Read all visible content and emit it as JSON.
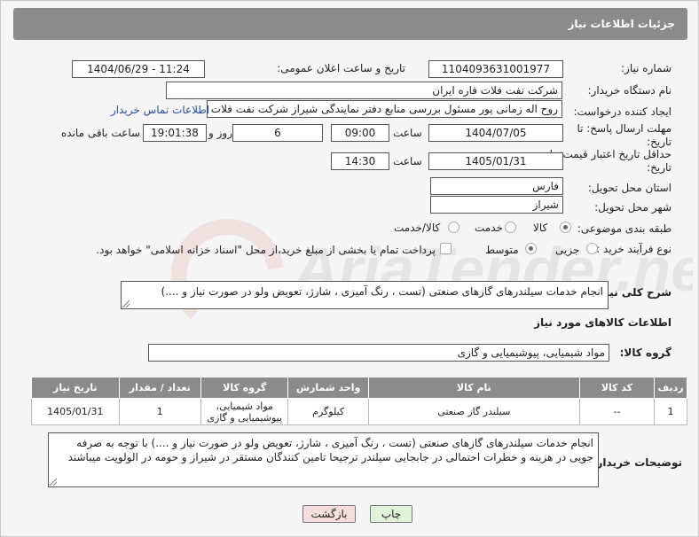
{
  "header": {
    "title": "جزئیات اطلاعات نیاز"
  },
  "fields": {
    "need_number_label": "شماره نیاز:",
    "need_number": "1104093631001977",
    "announce_label": "تاریخ و ساعت اعلان عمومی:",
    "announce_value": "1404/06/29 - 11:24",
    "buyer_org_label": "نام دستگاه خریدار:",
    "buyer_org": "شرکت نفت فلات قاره ایران",
    "creator_label": "ایجاد کننده درخواست:",
    "creator": "روح اله زمانی پور مسئول بررسی منابع دفتر نمایندگی شیراز شرکت نفت فلات ق",
    "contact_link": "اطلاعات تماس خریدار",
    "deadline_label": "مهلت ارسال پاسخ: تا تاریخ:",
    "deadline_date": "1404/07/05",
    "time_word": "ساعت",
    "deadline_time": "09:00",
    "days_value": "6",
    "days_word": "روز و",
    "remaining_time": "19:01:38",
    "remaining_word": "ساعت باقی مانده",
    "min_price_label": "حداقل تاریخ اعتبار قیمت: تا تاریخ:",
    "min_price_date": "1405/01/31",
    "min_price_time": "14:30",
    "province_label": "استان محل تحویل:",
    "province": "فارس",
    "city_label": "شهر محل تحویل:",
    "city": "شیراز",
    "category_label": "طبقه بندی موضوعی:",
    "category_options": [
      "کالا",
      "خدمت",
      "کالا/خدمت"
    ],
    "category_selected": "کالا",
    "process_label": "نوع فرآیند خرید :",
    "process_options": [
      "جزیی",
      "متوسط"
    ],
    "process_selected": "متوسط",
    "payment_note": "پرداخت تمام یا بخشی از مبلغ خرید،از محل \"اسناد خزانه اسلامی\" خواهد بود."
  },
  "description": {
    "label": "شرح کلی نیاز:",
    "text": "انجام خدمات سیلندرهای گازهای صنعتی (تست ، رنگ آمیزی ، شارژ، تعویض ولو در صورت نیاز و ....)"
  },
  "goods_section": {
    "title": "اطلاعات کالاهای مورد نیاز",
    "group_label": "گروه کالا:",
    "group_value": "مواد شیمیایی، پیوشیمیایی و  گازی"
  },
  "table": {
    "headers": [
      "ردیف",
      "کد کالا",
      "نام کالا",
      "واحد شمارش",
      "گروه کالا",
      "تعداد / مقدار",
      "تاریخ نیاز"
    ],
    "rows": [
      {
        "row": "1",
        "code": "--",
        "name": "سیلندر گاز صنعتی",
        "unit": "کیلوگرم",
        "group_line1": "مواد شیمیایی،",
        "group_line2": "پیوشیمیایی و گازی",
        "qty": "1",
        "date": "1405/01/31"
      }
    ]
  },
  "buyer_notes": {
    "label": "توضیحات خریدار:",
    "text": "انجام خدمات سیلندرهای گازهای صنعتی (تست ، رنگ آمیزی ، شارژ، تعویض ولو در صورت نیاز و ....) با توجه به صرفه جویی در هزینه و خطرات احتمالی در جابجایی سیلندر ترجیحا تامین کنندگان مستقر در شیراز و حومه در الولویت میباشند"
  },
  "buttons": {
    "print": "چاپ",
    "back": "بازگشت"
  },
  "colors": {
    "header_bg": "#8b8b8b",
    "link": "#2a4f9e",
    "print_btn": "#dff3d8",
    "back_btn": "#f7dede"
  },
  "watermark": "AriaTender.net"
}
